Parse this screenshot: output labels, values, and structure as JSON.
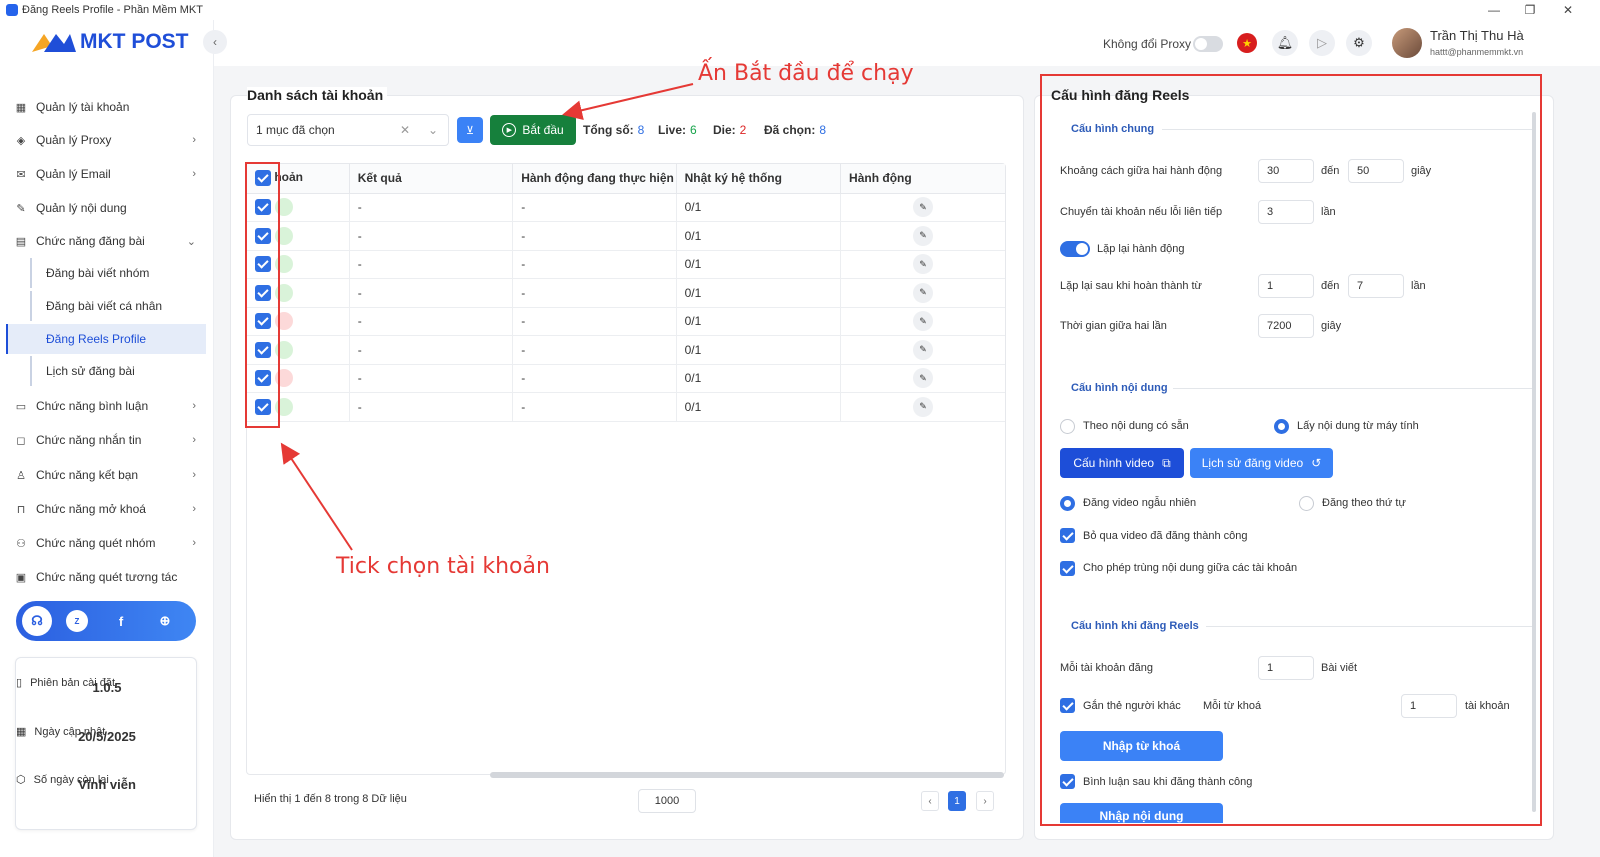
{
  "window": {
    "title": "Đăng Reels Profile - Phần Mềm MKT",
    "min": "—",
    "restore": "❐",
    "close": "✕"
  },
  "brand": {
    "name": "MKT POST"
  },
  "sidebar": {
    "items": [
      {
        "label": "Quản lý tài khoản",
        "icon": "grid-icon"
      },
      {
        "label": "Quản lý Proxy",
        "icon": "layers-icon"
      },
      {
        "label": "Quản lý Email",
        "icon": "mail-icon"
      },
      {
        "label": "Quản lý nội dung",
        "icon": "edit-icon"
      },
      {
        "label": "Chức năng đăng bài",
        "icon": "post-icon"
      }
    ],
    "subitems": [
      {
        "label": "Đăng bài viết nhóm"
      },
      {
        "label": "Đăng bài viết cá nhân"
      },
      {
        "label": "Đăng Reels Profile"
      },
      {
        "label": "Lịch sử đăng bài"
      }
    ],
    "items2": [
      {
        "label": "Chức năng bình luận",
        "icon": "comment-icon"
      },
      {
        "label": "Chức năng nhắn tin",
        "icon": "chat-icon"
      },
      {
        "label": "Chức năng kết bạn",
        "icon": "add-friend-icon"
      },
      {
        "label": "Chức năng mở khoá",
        "icon": "lock-icon"
      },
      {
        "label": "Chức năng quét nhóm",
        "icon": "users-icon"
      },
      {
        "label": "Chức năng quét tương tác",
        "icon": "chart-icon"
      }
    ],
    "info": {
      "version_label": "Phiên bản cài đặt",
      "version": "1.0.5",
      "updated_label": "Ngày cập nhật",
      "updated": "20/5/2025",
      "remaining_label": "Số ngày còn lại",
      "remaining": "Vĩnh viễn"
    }
  },
  "topbar": {
    "proxy_label": "Không đổi Proxy",
    "user_name": "Trần Thị Thu Hà",
    "user_email": "hattt@phanmemmkt.vn"
  },
  "accounts": {
    "title": "Danh sách tài khoản",
    "select_value": "1 mục đã chọn",
    "start_label": "Bắt đầu",
    "stats": {
      "total_label": "Tổng số:",
      "total": "8",
      "live_label": "Live:",
      "live": "6",
      "die_label": "Die:",
      "die": "2",
      "selected_label": "Đã chọn:",
      "selected": "8"
    },
    "columns": [
      "hoản",
      "Kết quả",
      "Hành động đang thực hiện",
      "Nhật ký hệ thống",
      "Hành động"
    ],
    "rows": [
      {
        "status": "live",
        "result": "-",
        "action": "-",
        "log": "0/1"
      },
      {
        "status": "live",
        "result": "-",
        "action": "-",
        "log": "0/1"
      },
      {
        "status": "live",
        "result": "-",
        "action": "-",
        "log": "0/1"
      },
      {
        "status": "live",
        "result": "-",
        "action": "-",
        "log": "0/1"
      },
      {
        "status": "die",
        "result": "-",
        "action": "-",
        "log": "0/1"
      },
      {
        "status": "live",
        "result": "-",
        "action": "-",
        "log": "0/1"
      },
      {
        "status": "die",
        "result": "-",
        "action": "-",
        "log": "0/1"
      },
      {
        "status": "live",
        "result": "-",
        "action": "-",
        "log": "0/1"
      }
    ],
    "footer": {
      "info": "Hiển thị 1 đến 8 trong 8 Dữ liệu",
      "page_size": "1000",
      "current_page": "1"
    }
  },
  "annotations": {
    "start": "Ấn Bắt đầu để chạy",
    "tick": "Tick chọn tài khoản"
  },
  "config": {
    "title": "Cấu hình đăng Reels",
    "general": {
      "title": "Cấu hình chung",
      "interval_label": "Khoảng cách giữa hai hành động",
      "interval_from": "30",
      "to_label": "đến",
      "interval_to": "50",
      "sec_label": "giây",
      "switch_label": "Chuyển tài khoản nếu lỗi liên tiếp",
      "switch_value": "3",
      "times_label": "lần",
      "repeat_label": "Lặp lại hành động",
      "repeat_after_label": "Lặp lại sau khi hoàn thành từ",
      "repeat_from": "1",
      "repeat_to": "7",
      "gap_label": "Thời gian giữa hai lần",
      "gap_value": "7200"
    },
    "content": {
      "title": "Cấu hình nội dung",
      "opt_available": "Theo nội dung có sẵn",
      "opt_computer": "Lấy nội dung từ máy tính",
      "video_cfg_btn": "Cấu hình video",
      "video_history_btn": "Lịch sử đăng video",
      "opt_random": "Đăng video ngẫu nhiên",
      "opt_order": "Đăng theo thứ tự",
      "skip_success": "Bỏ qua video đã đăng thành công",
      "allow_dup": "Cho phép trùng nội dung giữa các tài khoản"
    },
    "reels": {
      "title": "Cấu hình khi đăng Reels",
      "per_account_label": "Mỗi tài khoản đăng",
      "per_account": "1",
      "posts_label": "Bài viết",
      "tag_label": "Gắn thẻ người khác",
      "keyword_label": "Mỗi từ khoá",
      "keyword_value": "1",
      "accounts_label": "tài khoản",
      "import_keyword_btn": "Nhập từ khoá",
      "comment_label": "Bình luận sau khi đăng thành công",
      "import_content_btn": "Nhập nội dung"
    }
  },
  "colors": {
    "accent": "#2f6fe3",
    "start": "#16803c",
    "live": "#d9f3d9",
    "die": "#fcd9d9",
    "annotation": "#e53935"
  }
}
